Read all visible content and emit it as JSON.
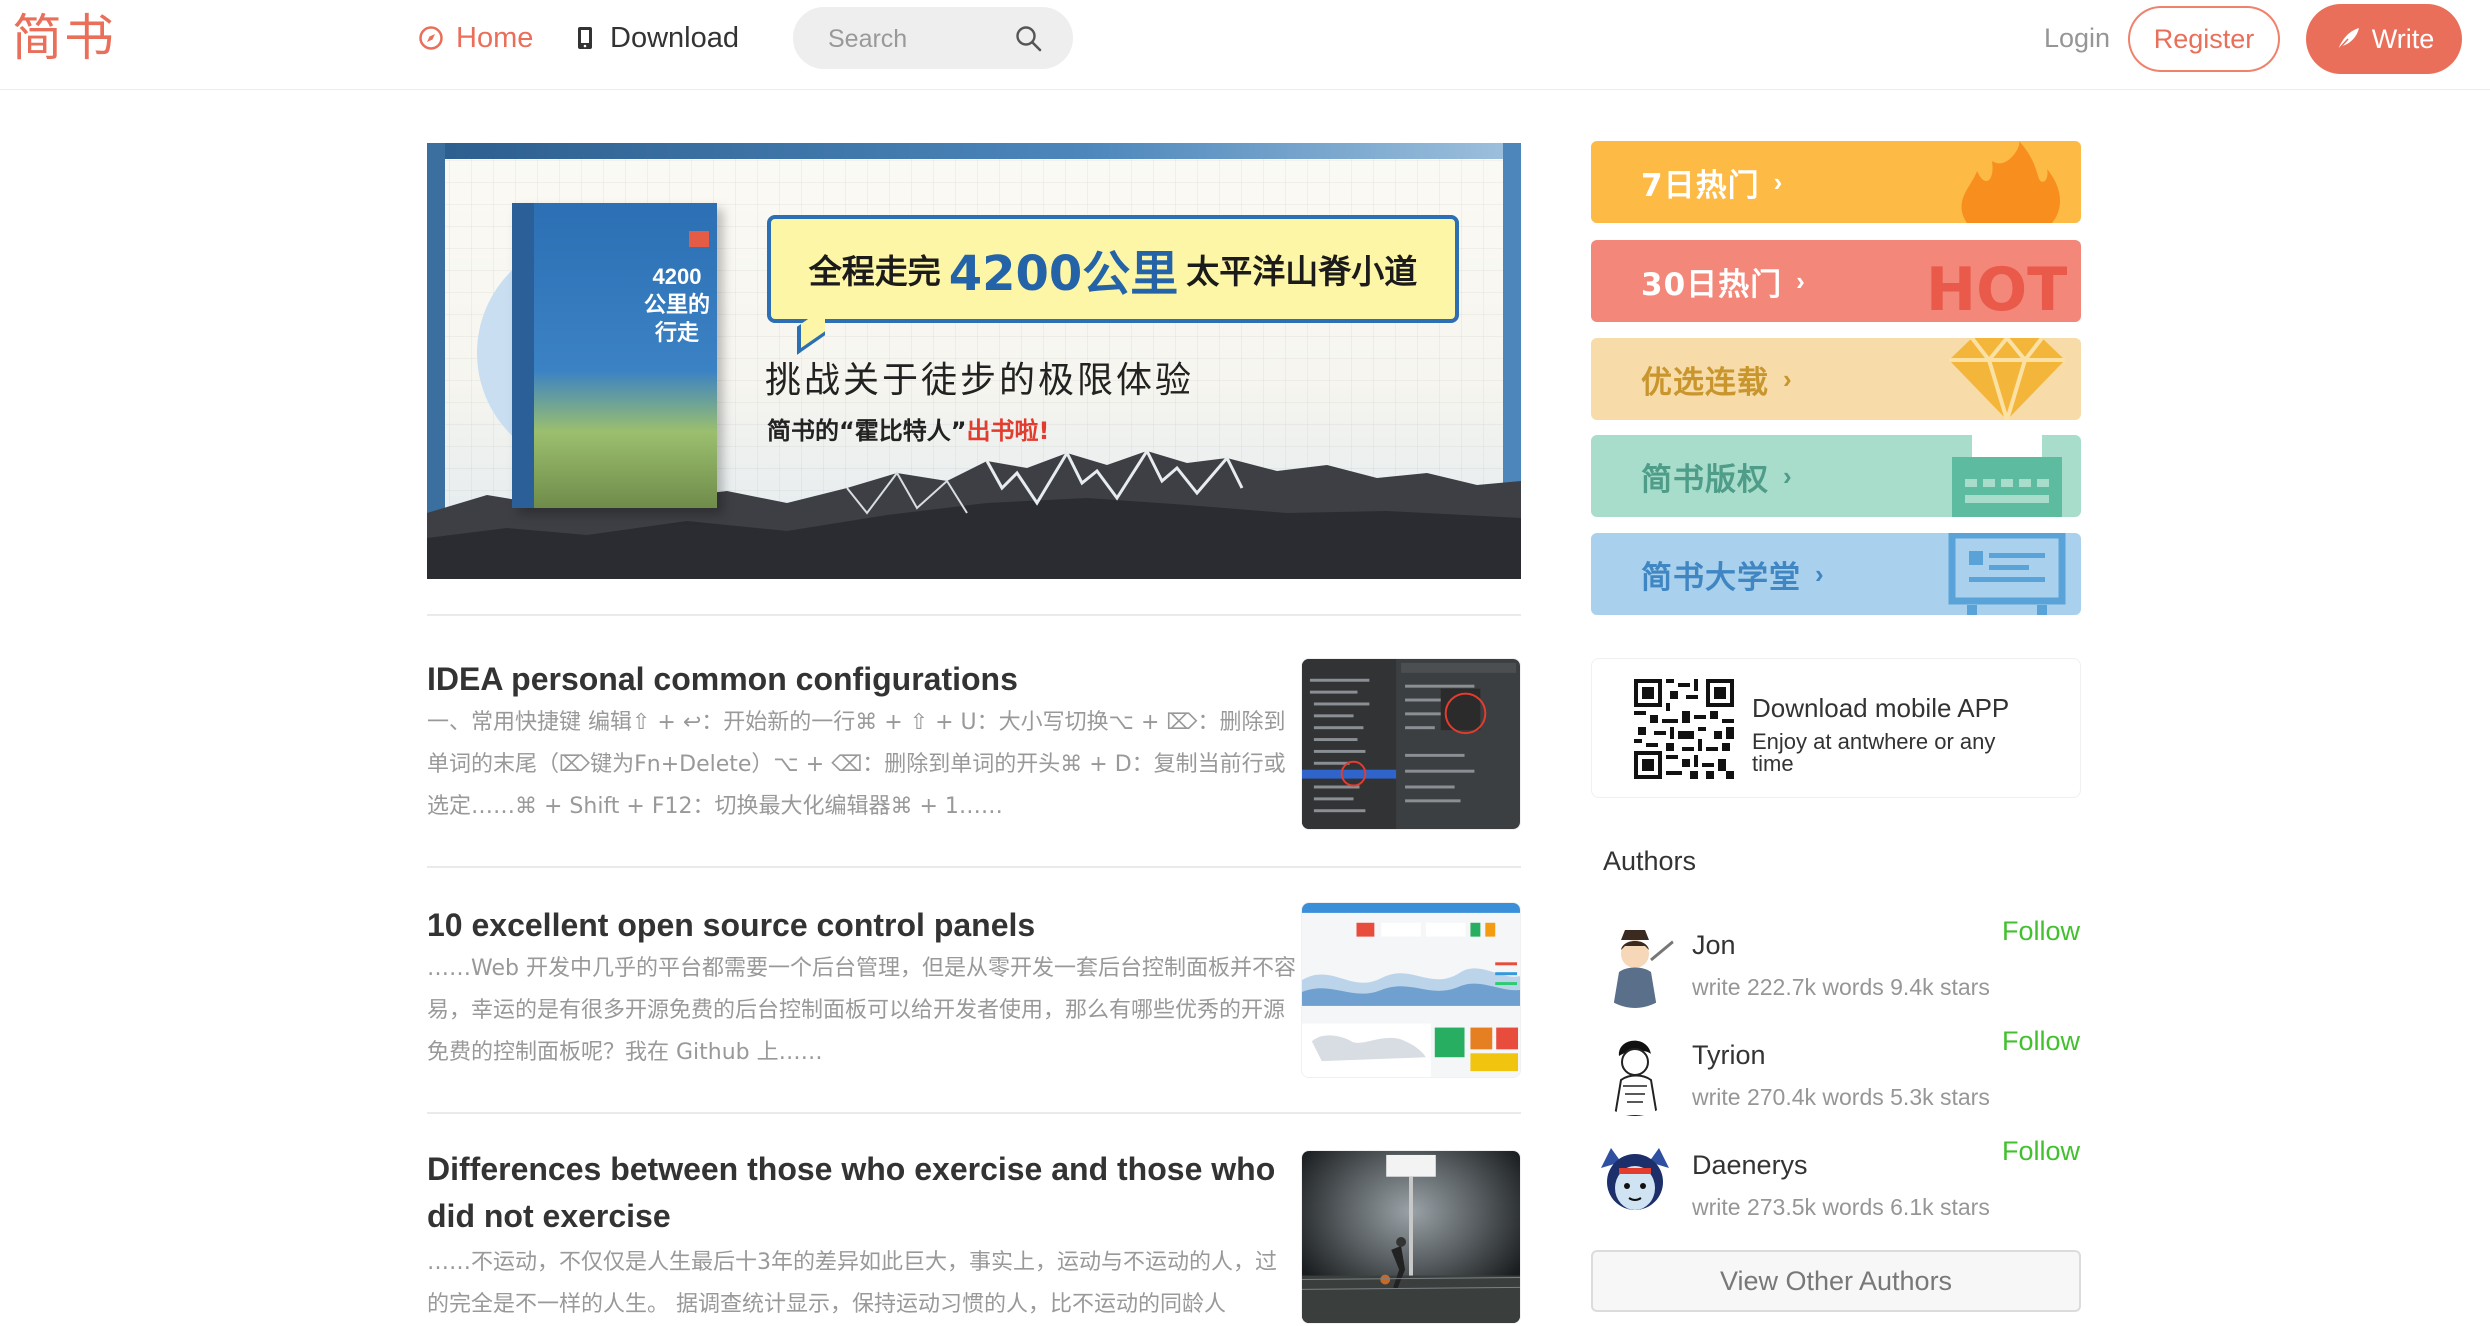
{
  "header": {
    "logo": "简书",
    "nav": {
      "home": "Home",
      "download": "Download"
    },
    "search": {
      "placeholder": "Search"
    },
    "login": "Login",
    "register": "Register",
    "write": "Write"
  },
  "banner": {
    "book_title": "4200公里的行走",
    "headline_pre": "全程走完",
    "headline_big": "4200公里",
    "headline_post": "太平洋山脊小道",
    "tagline": "挑战关于徒步的极限体验",
    "tagline2_pre": "简书的“霍比特人”",
    "tagline2_red": "出书啦!"
  },
  "articles": [
    {
      "title": "IDEA personal common configurations",
      "abstract": "一、常用快捷键 编辑⇧ + ↩：开始新的一行⌘ + ⇧ + U：大小写切换⌥ + ⌦：删除到单词的末尾（⌦键为Fn+Delete）⌥ + ⌫：删除到单词的开头⌘ + D：复制当前行或选定……⌘ + Shift + F12：切换最大化编辑器⌘ + 1……"
    },
    {
      "title": "10 excellent open source control panels",
      "abstract": "……Web 开发中几乎的平台都需要一个后台管理，但是从零开发一套后台控制面板并不容易，幸运的是有很多开源免费的后台控制面板可以给开发者使用，那么有哪些优秀的开源免费的控制面板呢？我在 Github 上……"
    },
    {
      "title": "Differences between those who exercise and those who did not exercise",
      "abstract": "……不运动，不仅仅是人生最后十3年的差异如此巨大，事实上，运动与不运动的人，过的完全是不一样的人生。 据调查统计显示，保持运动习惯的人，比不运动的同龄人"
    }
  ],
  "boards": [
    {
      "label": "7日热门",
      "color": "#fdba45",
      "art": "flame-icon"
    },
    {
      "label": "30日热门",
      "color": "#f3877a",
      "art": "hot-text-icon",
      "art_text": "HOT"
    },
    {
      "label": "优选连载",
      "color": "#f7dba8",
      "art": "diamond-icon"
    },
    {
      "label": "简书版权",
      "color": "#a8ddcc",
      "art": "typewriter-icon"
    },
    {
      "label": "简书大学堂",
      "color": "#a9d0ec",
      "art": "screen-icon"
    }
  ],
  "app_download": {
    "title": "Download mobile APP",
    "desc": "Enjoy at antwhere or any time"
  },
  "authors": {
    "heading": "Authors",
    "list": [
      {
        "name": "Jon",
        "meta": "write 222.7k words 9.4k stars",
        "follow": "Follow"
      },
      {
        "name": "Tyrion",
        "meta": "write 270.4k words 5.3k stars",
        "follow": "Follow"
      },
      {
        "name": "Daenerys",
        "meta": "write 273.5k words 6.1k stars",
        "follow": "Follow"
      }
    ],
    "view_all": "View Other Authors"
  },
  "colors": {
    "brand": "#ea6f5a",
    "follow": "#42c02e"
  }
}
